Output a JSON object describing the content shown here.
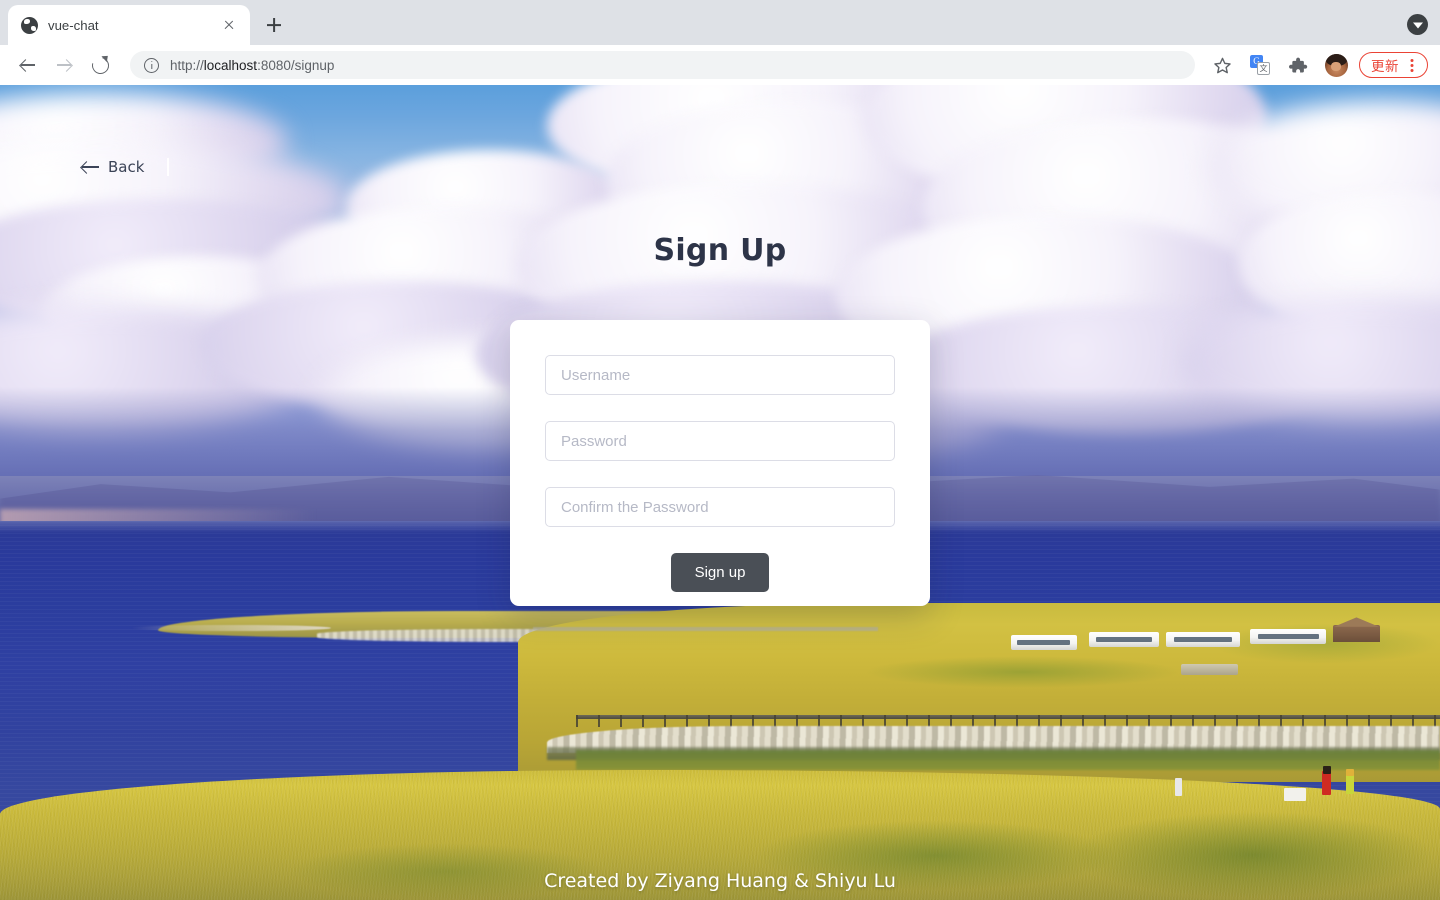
{
  "browser": {
    "tab": {
      "title": "vue-chat",
      "favicon_icon": "globe-icon",
      "close_icon": "close-icon"
    },
    "new_tab_icon": "plus-icon",
    "tab_search_icon": "chevron-down-circle-icon",
    "toolbar": {
      "back_icon": "arrow-left-icon",
      "forward_icon": "arrow-right-icon",
      "reload_icon": "reload-icon",
      "site_info_icon": "info-circle-icon",
      "url_scheme": "http://",
      "url_host": "localhost",
      "url_rest": ":8080/signup",
      "url_full": "http://localhost:8080/signup",
      "bookmark_icon": "star-icon",
      "translate_icon": "google-translate-icon",
      "translate_glyph_source": "G",
      "translate_glyph_target": "文",
      "extensions_icon": "puzzle-piece-icon",
      "profile_icon": "avatar",
      "update_label": "更新",
      "update_accent_color": "#ea4335",
      "menu_icon": "kebab-menu-icon"
    }
  },
  "page": {
    "back_link": {
      "label": "Back",
      "icon": "arrow-left-icon"
    },
    "title": "Sign Up",
    "title_color": "#2d3448",
    "form": {
      "fields": [
        {
          "name": "username",
          "placeholder": "Username",
          "value": "",
          "type": "text"
        },
        {
          "name": "password",
          "placeholder": "Password",
          "value": "",
          "type": "password"
        },
        {
          "name": "confirm_password",
          "placeholder": "Confirm the Password",
          "value": "",
          "type": "password"
        }
      ],
      "submit_label": "Sign up",
      "submit_color": "#4a4f56",
      "card_background": "#ffffff",
      "field_border_color": "#dcdde6",
      "placeholder_color": "#b6b9c6"
    },
    "footer_text": "Created by Ziyang Huang & Shiyu Lu",
    "background": {
      "description": "photograph of a blue alpine lake with golden grassland, distant hazy mountains and large cumulus clouds",
      "sky_color": "#5b9fdc",
      "cloud_color": "#e3dcf1",
      "lake_color": "#2f40a2",
      "grass_color": "#cdb93c"
    }
  }
}
